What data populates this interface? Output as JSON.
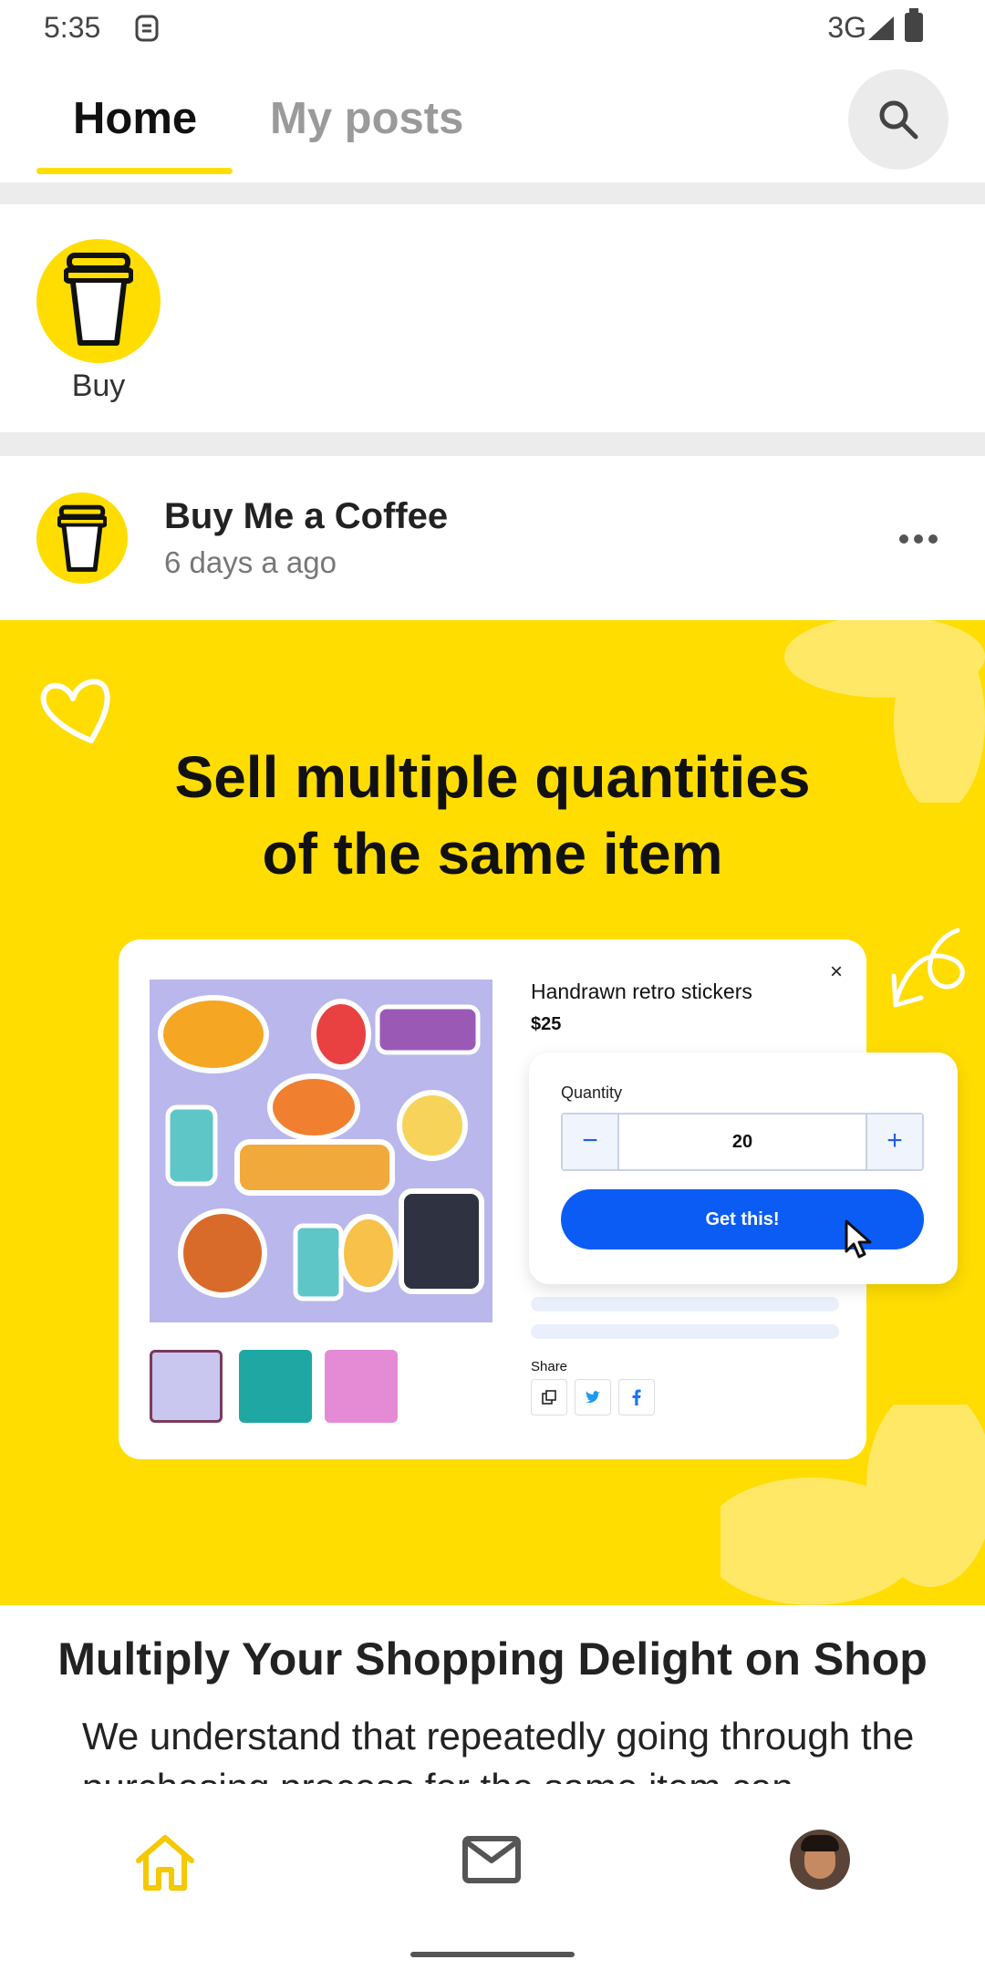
{
  "status_bar": {
    "time": "5:35",
    "network": "3G"
  },
  "top_tabs": {
    "home": "Home",
    "my_posts": "My posts",
    "active": "home"
  },
  "shortcuts": {
    "buy_label": "Buy"
  },
  "post": {
    "author": "Buy Me a Coffee",
    "time": "6 days a ago",
    "banner": {
      "title_line1": "Sell multiple quantities",
      "title_line2": "of the same item",
      "product_title": "Handrawn retro stickers",
      "price": "$25",
      "close": "×",
      "quantity_label": "Quantity",
      "quantity_value": "20",
      "minus": "−",
      "plus": "+",
      "cta": "Get this!",
      "share_label": "Share"
    },
    "article_title": "Multiply Your Shopping Delight on Shop",
    "article_body": "We understand that repeatedly going through the purchasing process for the same item can"
  },
  "colors": {
    "brand_yellow": "#ffdd00",
    "cta_blue": "#0a5cf5"
  },
  "icons": [
    "sim-icon",
    "signal-icon",
    "battery-icon",
    "search-icon",
    "coffee-cup-icon",
    "more-icon",
    "heart-icon",
    "arrow-icon",
    "cursor-icon",
    "copy-icon",
    "twitter-icon",
    "facebook-icon",
    "home-icon",
    "mail-icon"
  ]
}
